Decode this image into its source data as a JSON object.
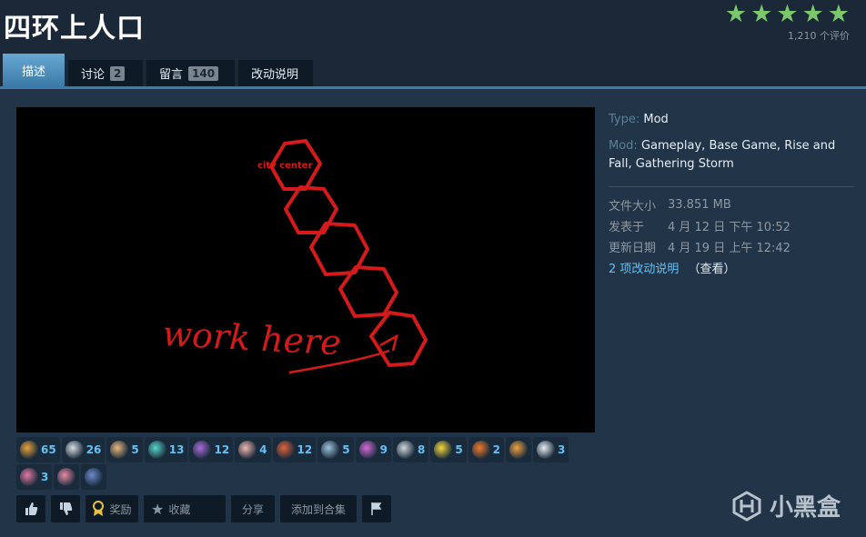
{
  "title": "四环上人口",
  "rating": {
    "stars": 5,
    "count_text": "1,210 个评价"
  },
  "tabs": [
    {
      "label": "描述",
      "count": ""
    },
    {
      "label": "讨论",
      "count": "2"
    },
    {
      "label": "留言",
      "count": "140"
    },
    {
      "label": "改动说明",
      "count": ""
    }
  ],
  "preview": {
    "text_city": "city center",
    "text_work": "work here"
  },
  "details": {
    "type_label": "Type:",
    "type_value": "Mod",
    "mod_label": "Mod:",
    "mod_values": "Gameplay, Base Game, Rise and Fall, Gathering Storm",
    "file_size_label": "文件大小",
    "file_size": "33.851 MB",
    "posted_label": "发表于",
    "posted": "4 月 12 日 下午 10:52",
    "updated_label": "更新日期",
    "updated": "4 月 19 日 上午 12:42",
    "changes_link": "2 项改动说明",
    "view_link": "（查看）"
  },
  "awards": [
    {
      "icon": "gun-award-icon",
      "color": "#e8a23a",
      "count": "65"
    },
    {
      "icon": "wings-award-icon",
      "color": "#d8dde3",
      "count": "26"
    },
    {
      "icon": "hand-award-icon",
      "color": "#e9b77c",
      "count": "5"
    },
    {
      "icon": "comet-award-icon",
      "color": "#56d6c8",
      "count": "13"
    },
    {
      "icon": "heart-award-icon",
      "color": "#a66ad8",
      "count": "12"
    },
    {
      "icon": "brain-award-icon",
      "color": "#f2b7b0",
      "count": "4"
    },
    {
      "icon": "gift-award-icon",
      "color": "#e0643a",
      "count": "12"
    },
    {
      "icon": "ghost-award-icon",
      "color": "#9ec2d8",
      "count": "5"
    },
    {
      "icon": "ufo-award-icon",
      "color": "#d46ad8",
      "count": "9"
    },
    {
      "icon": "skull-award-icon",
      "color": "#cfd5db",
      "count": "8"
    },
    {
      "icon": "sun-award-icon",
      "color": "#f4d63a",
      "count": "5"
    },
    {
      "icon": "flame-award-icon",
      "color": "#f07b2e",
      "count": "2"
    },
    {
      "icon": "fox-award-icon",
      "color": "#f0a040",
      "count": ""
    },
    {
      "icon": "snowman-award-icon",
      "color": "#e8eef4",
      "count": "3"
    },
    {
      "icon": "fish-award-icon",
      "color": "#e279a0",
      "count": "3"
    },
    {
      "icon": "pig-award-icon",
      "color": "#e88aa6",
      "count": ""
    },
    {
      "icon": "wolf-award-icon",
      "color": "#6c8ac8",
      "count": ""
    }
  ],
  "actions": {
    "award_label": "奖励",
    "favorite_label": "收藏",
    "share_label": "分享",
    "add_collection_label": "添加到合集"
  },
  "watermark": {
    "text": "小黑盒"
  }
}
